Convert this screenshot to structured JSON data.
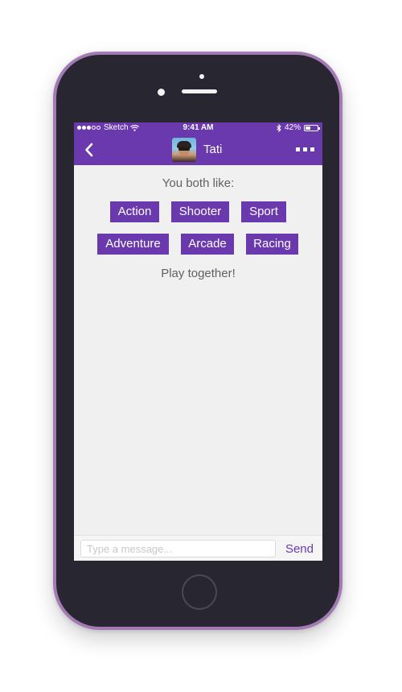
{
  "status_bar": {
    "carrier": "Sketch",
    "time": "9:41 AM",
    "battery": "42%",
    "battery_level": 0.42,
    "icons": [
      "signal-dots-icon",
      "wifi-icon",
      "bluetooth-icon",
      "battery-icon"
    ]
  },
  "nav": {
    "back_icon": "chevron-left-icon",
    "contact_name": "Tati",
    "more_icon": "ellipsis-icon"
  },
  "match": {
    "heading": "You both like:",
    "tags": [
      "Action",
      "Shooter",
      "Sport",
      "Adventure",
      "Arcade",
      "Racing"
    ],
    "footer": "Play together!"
  },
  "composer": {
    "placeholder": "Type a message...",
    "value": "",
    "send_label": "Send"
  },
  "colors": {
    "accent": "#6a39ae",
    "frame": "#282631",
    "frame_border": "#a37ab4",
    "screen_bg": "#f0f0f0",
    "text_muted": "#616161"
  }
}
